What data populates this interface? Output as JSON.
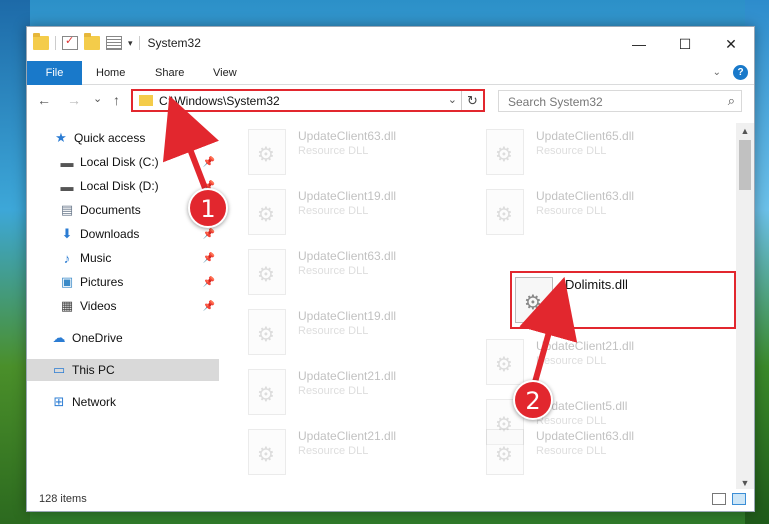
{
  "window": {
    "title": "System32",
    "controls": {
      "minimize": "—",
      "maximize": "☐",
      "close": "✕"
    }
  },
  "ribbon": {
    "tabs": [
      "File",
      "Home",
      "Share",
      "View"
    ],
    "help_label": "?"
  },
  "navigation": {
    "back": "←",
    "forward": "→",
    "recent": "⌄",
    "up": "↑",
    "address": "C:\\Windows\\System32",
    "refresh": "↻",
    "dropdown": "⌄",
    "search_placeholder": "Search System32"
  },
  "sidebar": {
    "items": [
      {
        "label": "Quick access",
        "icon": "star-icon",
        "pinned": false
      },
      {
        "label": "Local Disk (C:)",
        "icon": "drive-icon",
        "pinned": true
      },
      {
        "label": "Local Disk (D:)",
        "icon": "drive-icon",
        "pinned": true
      },
      {
        "label": "Documents",
        "icon": "documents-icon",
        "pinned": true
      },
      {
        "label": "Downloads",
        "icon": "downloads-icon",
        "pinned": true
      },
      {
        "label": "Music",
        "icon": "music-icon",
        "pinned": true
      },
      {
        "label": "Pictures",
        "icon": "pictures-icon",
        "pinned": true
      },
      {
        "label": "Videos",
        "icon": "videos-icon",
        "pinned": true
      },
      {
        "label": "OneDrive",
        "icon": "cloud-icon",
        "pinned": false
      },
      {
        "label": "This PC",
        "icon": "computer-icon",
        "pinned": false,
        "selected": true
      },
      {
        "label": "Network",
        "icon": "network-icon",
        "pinned": false
      }
    ]
  },
  "files": [
    {
      "name": "UpdateClient63.dll",
      "type": "Resource DLL"
    },
    {
      "name": "UpdateClient65.dll",
      "type": "Resource DLL"
    },
    {
      "name": "UpdateClient19.dll",
      "type": "Resource DLL"
    },
    {
      "name": "UpdateClient63.dll",
      "type": "Resource DLL"
    },
    {
      "name": "UpdateClient63.dll",
      "type": "Resource DLL"
    },
    {
      "name": "Dolimits.dll",
      "type": ""
    },
    {
      "name": "UpdateClient19.dll",
      "type": "Resource DLL"
    },
    {
      "name": "UpdateClient21.dll",
      "type": "Resource DLL"
    },
    {
      "name": "UpdateClient21.dll",
      "type": "Resource DLL"
    },
    {
      "name": "UpdateClient5.dll",
      "type": "Resource DLL"
    },
    {
      "name": "UpdateClient21.dll",
      "type": "Resource DLL"
    },
    {
      "name": "UpdateClient63.dll",
      "type": "Resource DLL"
    }
  ],
  "highlighted_file": "Dolimits.dll",
  "annotations": [
    {
      "label": "1"
    },
    {
      "label": "2"
    }
  ],
  "status": {
    "item_count": "128 items"
  },
  "colors": {
    "accent": "#1979ca",
    "highlight": "#e2272e"
  }
}
